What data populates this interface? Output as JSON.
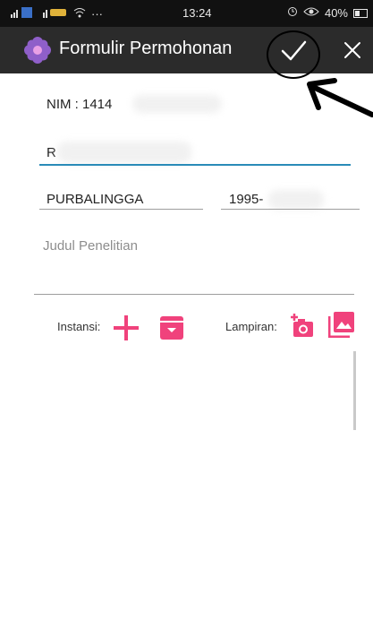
{
  "status_bar": {
    "time": "13:24",
    "battery": "40%",
    "more": "···"
  },
  "app_bar": {
    "title": "Formulir Permohonan",
    "confirm_icon": "check-icon",
    "close_icon": "close-icon",
    "logo_icon": "flower-logo-icon"
  },
  "form": {
    "nim_value": "NIM : 1414",
    "name_value": "R",
    "city_value": "PURBALINGGA",
    "date_value": "1995-",
    "title_placeholder": "Judul Penelitian"
  },
  "attachments": {
    "instansi_label": "Instansi:",
    "lampiran_label": "Lampiran:"
  },
  "colors": {
    "accent_pink": "#f0427c",
    "focus_blue": "#2a8bb8",
    "app_bar_bg": "#2b2b2b"
  }
}
